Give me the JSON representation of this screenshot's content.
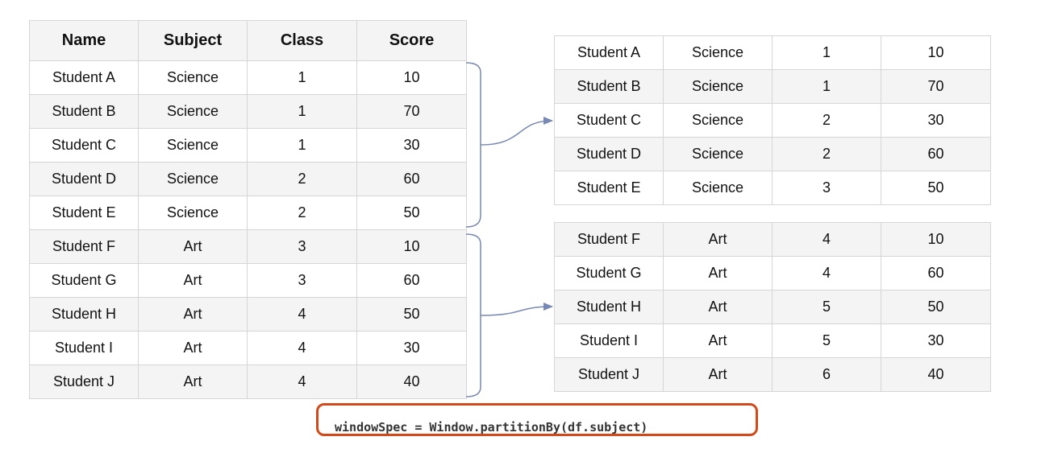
{
  "main_table": {
    "headers": [
      "Name",
      "Subject",
      "Class",
      "Score"
    ],
    "rows": [
      [
        "Student A",
        "Science",
        "1",
        "10"
      ],
      [
        "Student B",
        "Science",
        "1",
        "70"
      ],
      [
        "Student C",
        "Science",
        "1",
        "30"
      ],
      [
        "Student D",
        "Science",
        "2",
        "60"
      ],
      [
        "Student E",
        "Science",
        "2",
        "50"
      ],
      [
        "Student F",
        "Art",
        "3",
        "10"
      ],
      [
        "Student G",
        "Art",
        "3",
        "60"
      ],
      [
        "Student H",
        "Art",
        "4",
        "50"
      ],
      [
        "Student I",
        "Art",
        "4",
        "30"
      ],
      [
        "Student J",
        "Art",
        "4",
        "40"
      ]
    ]
  },
  "science_partition": {
    "rows": [
      [
        "Student A",
        "Science",
        "1",
        "10"
      ],
      [
        "Student B",
        "Science",
        "1",
        "70"
      ],
      [
        "Student C",
        "Science",
        "2",
        "30"
      ],
      [
        "Student D",
        "Science",
        "2",
        "60"
      ],
      [
        "Student E",
        "Science",
        "3",
        "50"
      ]
    ]
  },
  "art_partition": {
    "rows": [
      [
        "Student F",
        "Art",
        "4",
        "10"
      ],
      [
        "Student G",
        "Art",
        "4",
        "60"
      ],
      [
        "Student H",
        "Art",
        "5",
        "50"
      ],
      [
        "Student I",
        "Art",
        "5",
        "30"
      ],
      [
        "Student J",
        "Art",
        "6",
        "40"
      ]
    ]
  },
  "code": "windowSpec = Window.partitionBy(df.subject)",
  "colors": {
    "connector": "#7788b3",
    "code_border": "#d24a17",
    "header_bg": "#f4f4f4",
    "alt_row_bg": "#f4f4f4",
    "border": "#d6d6d6"
  }
}
